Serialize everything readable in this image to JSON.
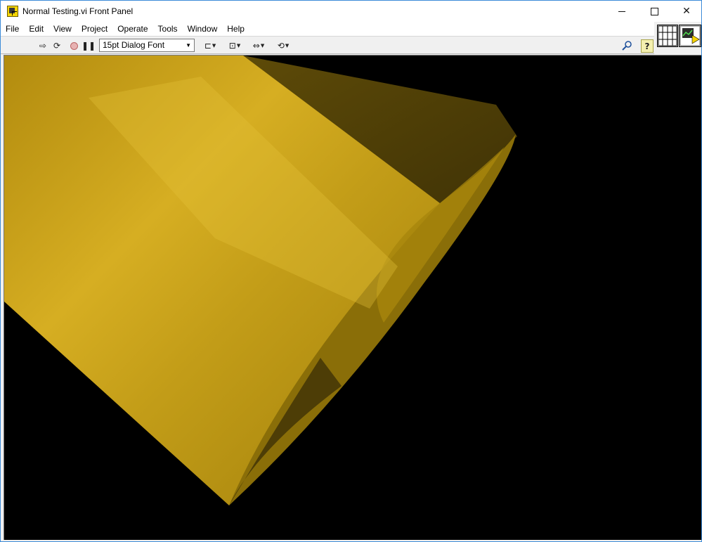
{
  "window": {
    "title": "Normal Testing.vi Front Panel",
    "minimize_glyph": "",
    "maximize_glyph": "",
    "close_glyph": "✕"
  },
  "menu": {
    "items": [
      {
        "label": "File"
      },
      {
        "label": "Edit"
      },
      {
        "label": "View"
      },
      {
        "label": "Project"
      },
      {
        "label": "Operate"
      },
      {
        "label": "Tools"
      },
      {
        "label": "Window"
      },
      {
        "label": "Help"
      }
    ]
  },
  "toolbar": {
    "font_select": "15pt Dialog Font",
    "icons": {
      "run": "run-arrow-icon",
      "run_continuously": "run-continuously-icon",
      "abort": "abort-execution-icon",
      "pause": "pause-icon",
      "align": "align-objects-icon",
      "distribute": "distribute-objects-icon",
      "resize": "resize-objects-icon",
      "reorder": "reorder-icon",
      "search": "search-icon",
      "help": "context-help-icon"
    }
  },
  "panel": {
    "background": "#000000",
    "cylinder_color": "#b89412",
    "cylinder_dark": "#5a4707"
  }
}
